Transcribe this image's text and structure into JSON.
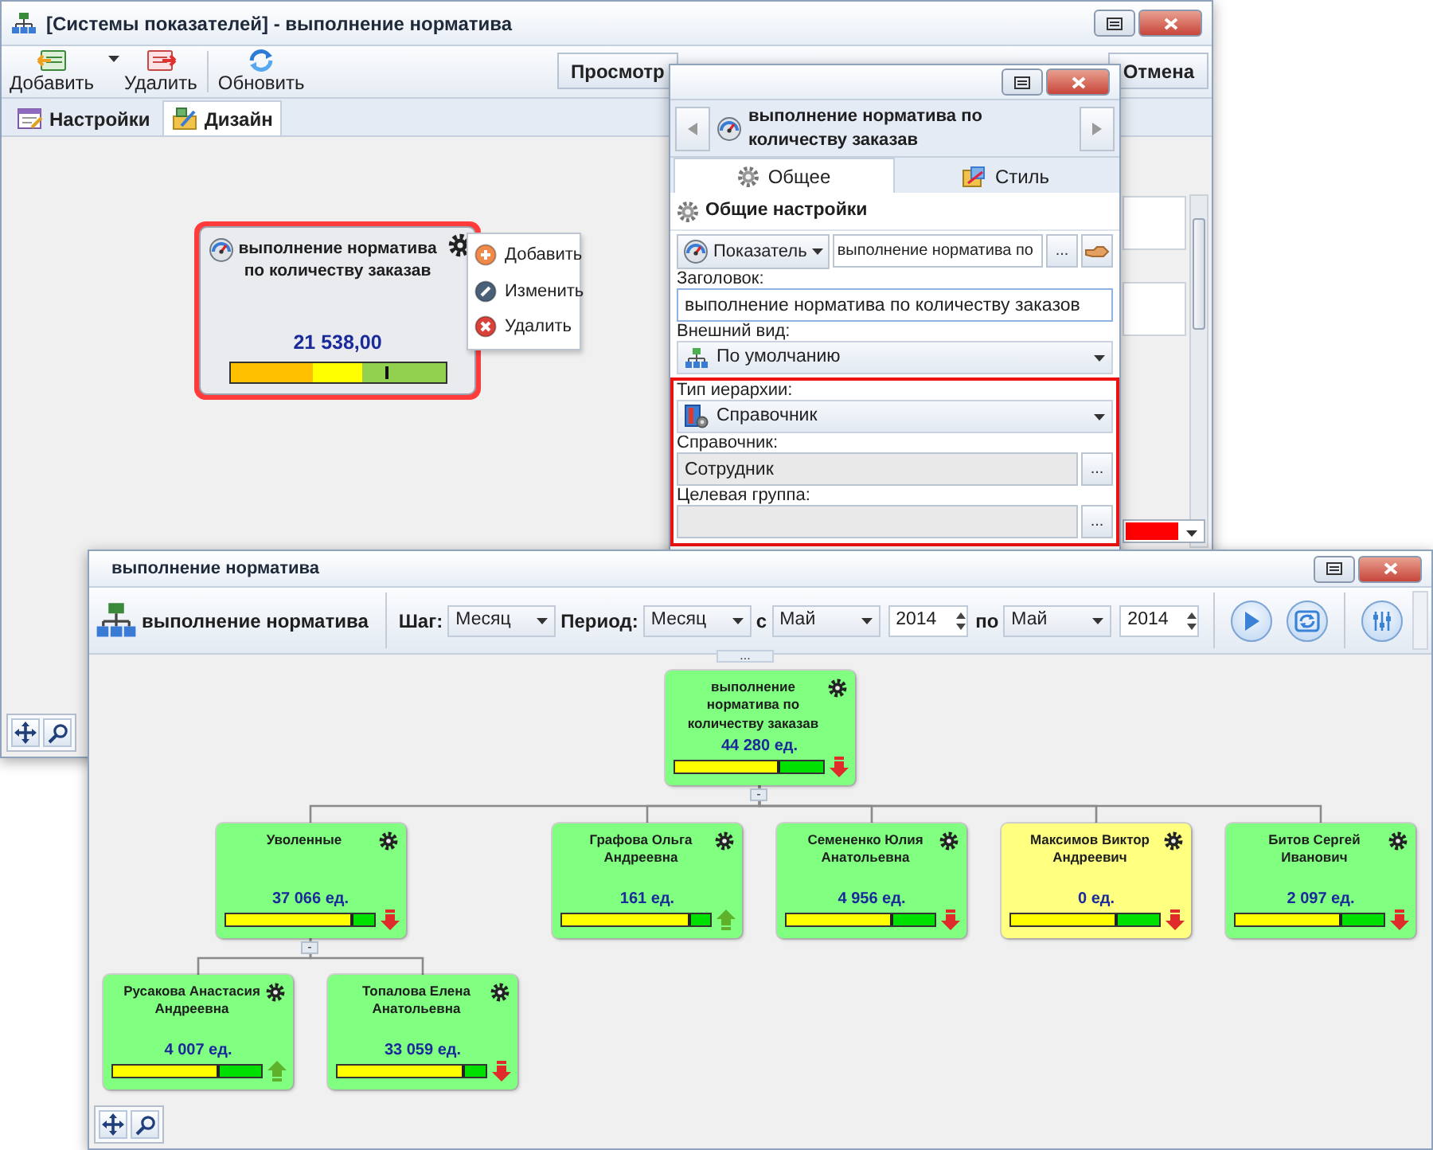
{
  "main_window": {
    "title": "[Системы показателей] - выполнение норматива",
    "toolbar": [
      {
        "label": "Добавить",
        "kind": "add",
        "has_dropdown": true
      },
      {
        "label": "Удалить",
        "kind": "remove",
        "has_dropdown": false
      },
      {
        "label": "Обновить",
        "kind": "refresh",
        "has_dropdown": false
      }
    ],
    "action_buttons": [
      {
        "label": "Просмотр"
      },
      {
        "label": "Отмена"
      }
    ],
    "tabs": [
      {
        "label": "Настройки",
        "kind": "settings",
        "selected": false
      },
      {
        "label": "Дизайн",
        "kind": "design",
        "selected": true
      }
    ],
    "widget": {
      "title": "выполнение норматива по количеству заказав",
      "value": "21 538,00",
      "selected": true,
      "level": 0.72
    },
    "context_menu": [
      {
        "label": "Добавить",
        "kind": "add"
      },
      {
        "label": "Изменить",
        "kind": "edit"
      },
      {
        "label": "Удалить",
        "kind": "delete"
      }
    ]
  },
  "properties_window": {
    "header": "выполнение норматива по количеству заказав",
    "tabs": [
      {
        "label": "Общее",
        "kind": "general",
        "selected": true
      },
      {
        "label": "Стиль",
        "kind": "style",
        "selected": false
      }
    ],
    "section": "Общие настройки",
    "source": {
      "type": "Показатель",
      "value": "выполнение норматива по",
      "button_label": "..."
    },
    "fields": [
      {
        "label": "Заголовок:",
        "kind": "text",
        "value": "выполнение норматива по количеству заказов",
        "highlighted": false
      },
      {
        "label": "Внешний вид:",
        "kind": "view",
        "value": "По умолчанию",
        "highlighted": false
      },
      {
        "label": "Тип иерархии:",
        "kind": "hierarchy",
        "value": "Справочник",
        "highlighted": true
      },
      {
        "label": "Справочник:",
        "kind": "browse",
        "value": "Сотрудник",
        "button_label": "...",
        "highlighted": true
      },
      {
        "label": "Целевая группа:",
        "kind": "browse",
        "button_label": "...",
        "highlighted": true
      }
    ]
  },
  "chart_window": {
    "title": "выполнение норматива",
    "heading": "выполнение норматива",
    "filters": [
      {
        "label": "Шаг:",
        "kind": "select",
        "value": "Месяц"
      },
      {
        "label": "Период:",
        "kind": "select",
        "value": "Месяц"
      },
      {
        "label": "с",
        "kind": "select",
        "value": "Май"
      },
      {
        "kind": "spinner",
        "value": "2014"
      },
      {
        "label": "по",
        "kind": "select",
        "value": "Май"
      },
      {
        "kind": "spinner",
        "value": "2014"
      }
    ],
    "actions": [
      {
        "kind": "play"
      },
      {
        "kind": "refresh"
      },
      {
        "kind": "settings"
      }
    ],
    "splitter_label": "...",
    "tree": {
      "title": "выполнение норматива по количеству заказав",
      "value": "44 280 ед.",
      "color": "#80ff80",
      "level": 0.72,
      "kind": "down",
      "toggle_label": "-",
      "children": [
        {
          "title": "Уволенные",
          "value": "37 066 ед.",
          "color": "#80ff80",
          "level": 0.87,
          "kind": "down",
          "toggle_label": "-",
          "children": [
            {
              "title": "Русакова Анастасия Андреевна",
              "value": "4 007 ед.",
              "color": "#80ff80",
              "level": 0.72,
              "kind": "up"
            },
            {
              "title": "Топалова Елена Анатольевна",
              "value": "33 059 ед.",
              "color": "#80ff80",
              "level": 0.86,
              "kind": "down"
            }
          ]
        },
        {
          "title": "Графова Ольга Андреевна",
          "value": "161 ед.",
          "color": "#80ff80",
          "level": 0.87,
          "kind": "up"
        },
        {
          "title": "Семененко Юлия Анатольевна",
          "value": "4 956 ед.",
          "color": "#80ff80",
          "level": 0.72,
          "kind": "down"
        },
        {
          "title": "Максимов Виктор Андреевич",
          "value": "0 ед.",
          "color": "#ffff80",
          "level": 0.72,
          "kind": "down"
        },
        {
          "title": "Битов Сергей Иванович",
          "value": "2 097 ед.",
          "color": "#80ff80",
          "level": 0.72,
          "kind": "down"
        }
      ]
    }
  }
}
